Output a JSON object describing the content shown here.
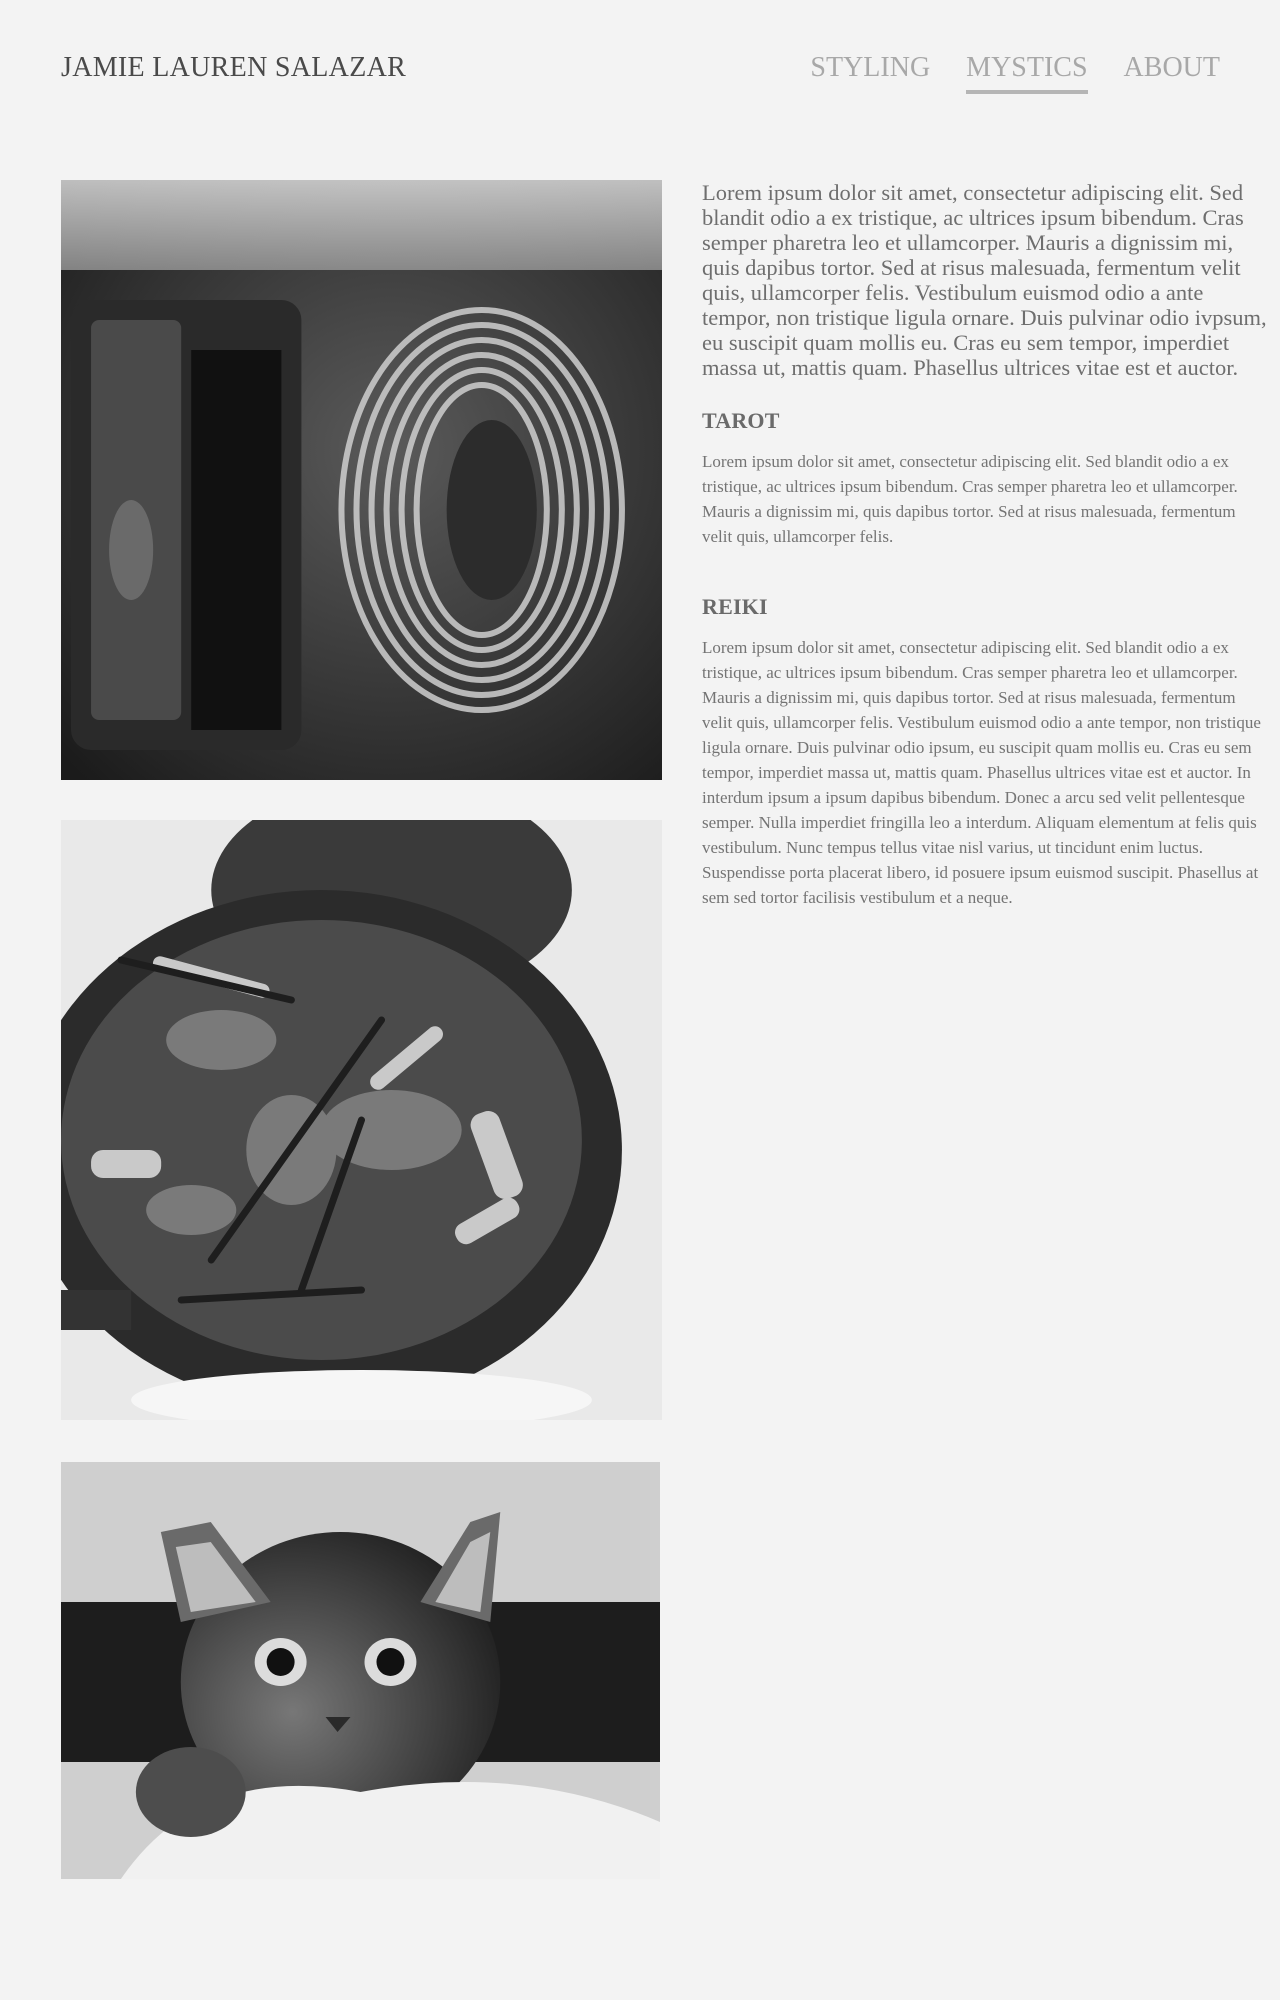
{
  "header": {
    "site_title": "JAMIE LAUREN SALAZAR",
    "nav": [
      {
        "label": "STYLING",
        "active": false
      },
      {
        "label": "MYSTICS",
        "active": true
      },
      {
        "label": "ABOUT",
        "active": false
      }
    ]
  },
  "photos": [
    {
      "subject": "coil-inductor-photo"
    },
    {
      "subject": "food-skillet-photo"
    },
    {
      "subject": "kitten-photo"
    }
  ],
  "main": {
    "intro": "Lorem ipsum dolor sit amet, consectetur adipiscing elit. Sed blandit odio a ex tristique, ac ultrices ipsum bibendum. Cras semper pharetra leo et ullamcorper. Mauris a dignissim mi, quis dapibus tortor. Sed at risus malesuada, fermentum velit quis, ullamcorper felis. Vestibulum euismod odio a ante tempor, non tristique ligula ornare. Duis pulvinar odio ivpsum, eu suscipit quam mollis eu. Cras eu sem tempor, imperdiet massa ut, mattis quam. Phasellus ultrices vitae est et auctor.",
    "sections": [
      {
        "heading": "TAROT",
        "text": "Lorem ipsum dolor sit amet, consectetur adipiscing elit. Sed blandit odio a ex tristique, ac ultrices ipsum bibendum. Cras semper pharetra leo et ullamcorper. Mauris a dignissim mi, quis dapibus tortor. Sed at risus malesuada, fermentum velit quis, ullamcorper felis."
      },
      {
        "heading": "REIKI",
        "text": "Lorem ipsum dolor sit amet, consectetur adipiscing elit. Sed blandit odio a ex tristique, ac ultrices ipsum bibendum. Cras semper pharetra leo et ullamcorper. Mauris a dignissim mi, quis dapibus tortor. Sed at risus malesuada, fermentum velit quis, ullamcorper felis. Vestibulum euismod odio a ante tempor, non tristique ligula ornare. Duis pulvinar odio ipsum, eu suscipit quam mollis eu. Cras eu sem tempor, imperdiet massa ut, mattis quam. Phasellus ultrices vitae est et auctor. In interdum ipsum a ipsum dapibus bibendum. Donec a arcu sed velit pellentesque semper. Nulla imperdiet fringilla leo a interdum. Aliquam elementum at felis quis vestibulum. Nunc tempus tellus vitae nisl varius, ut tincidunt enim luctus. Suspendisse porta placerat libero, id posuere ipsum euismod suscipit. Phasellus at sem sed tortor facilisis vestibulum et a neque."
      }
    ]
  },
  "colors": {
    "background": "#f3f3f3",
    "title": "#4a4a4a",
    "nav": "#a8a8a8",
    "text": "#6e6e6e"
  }
}
